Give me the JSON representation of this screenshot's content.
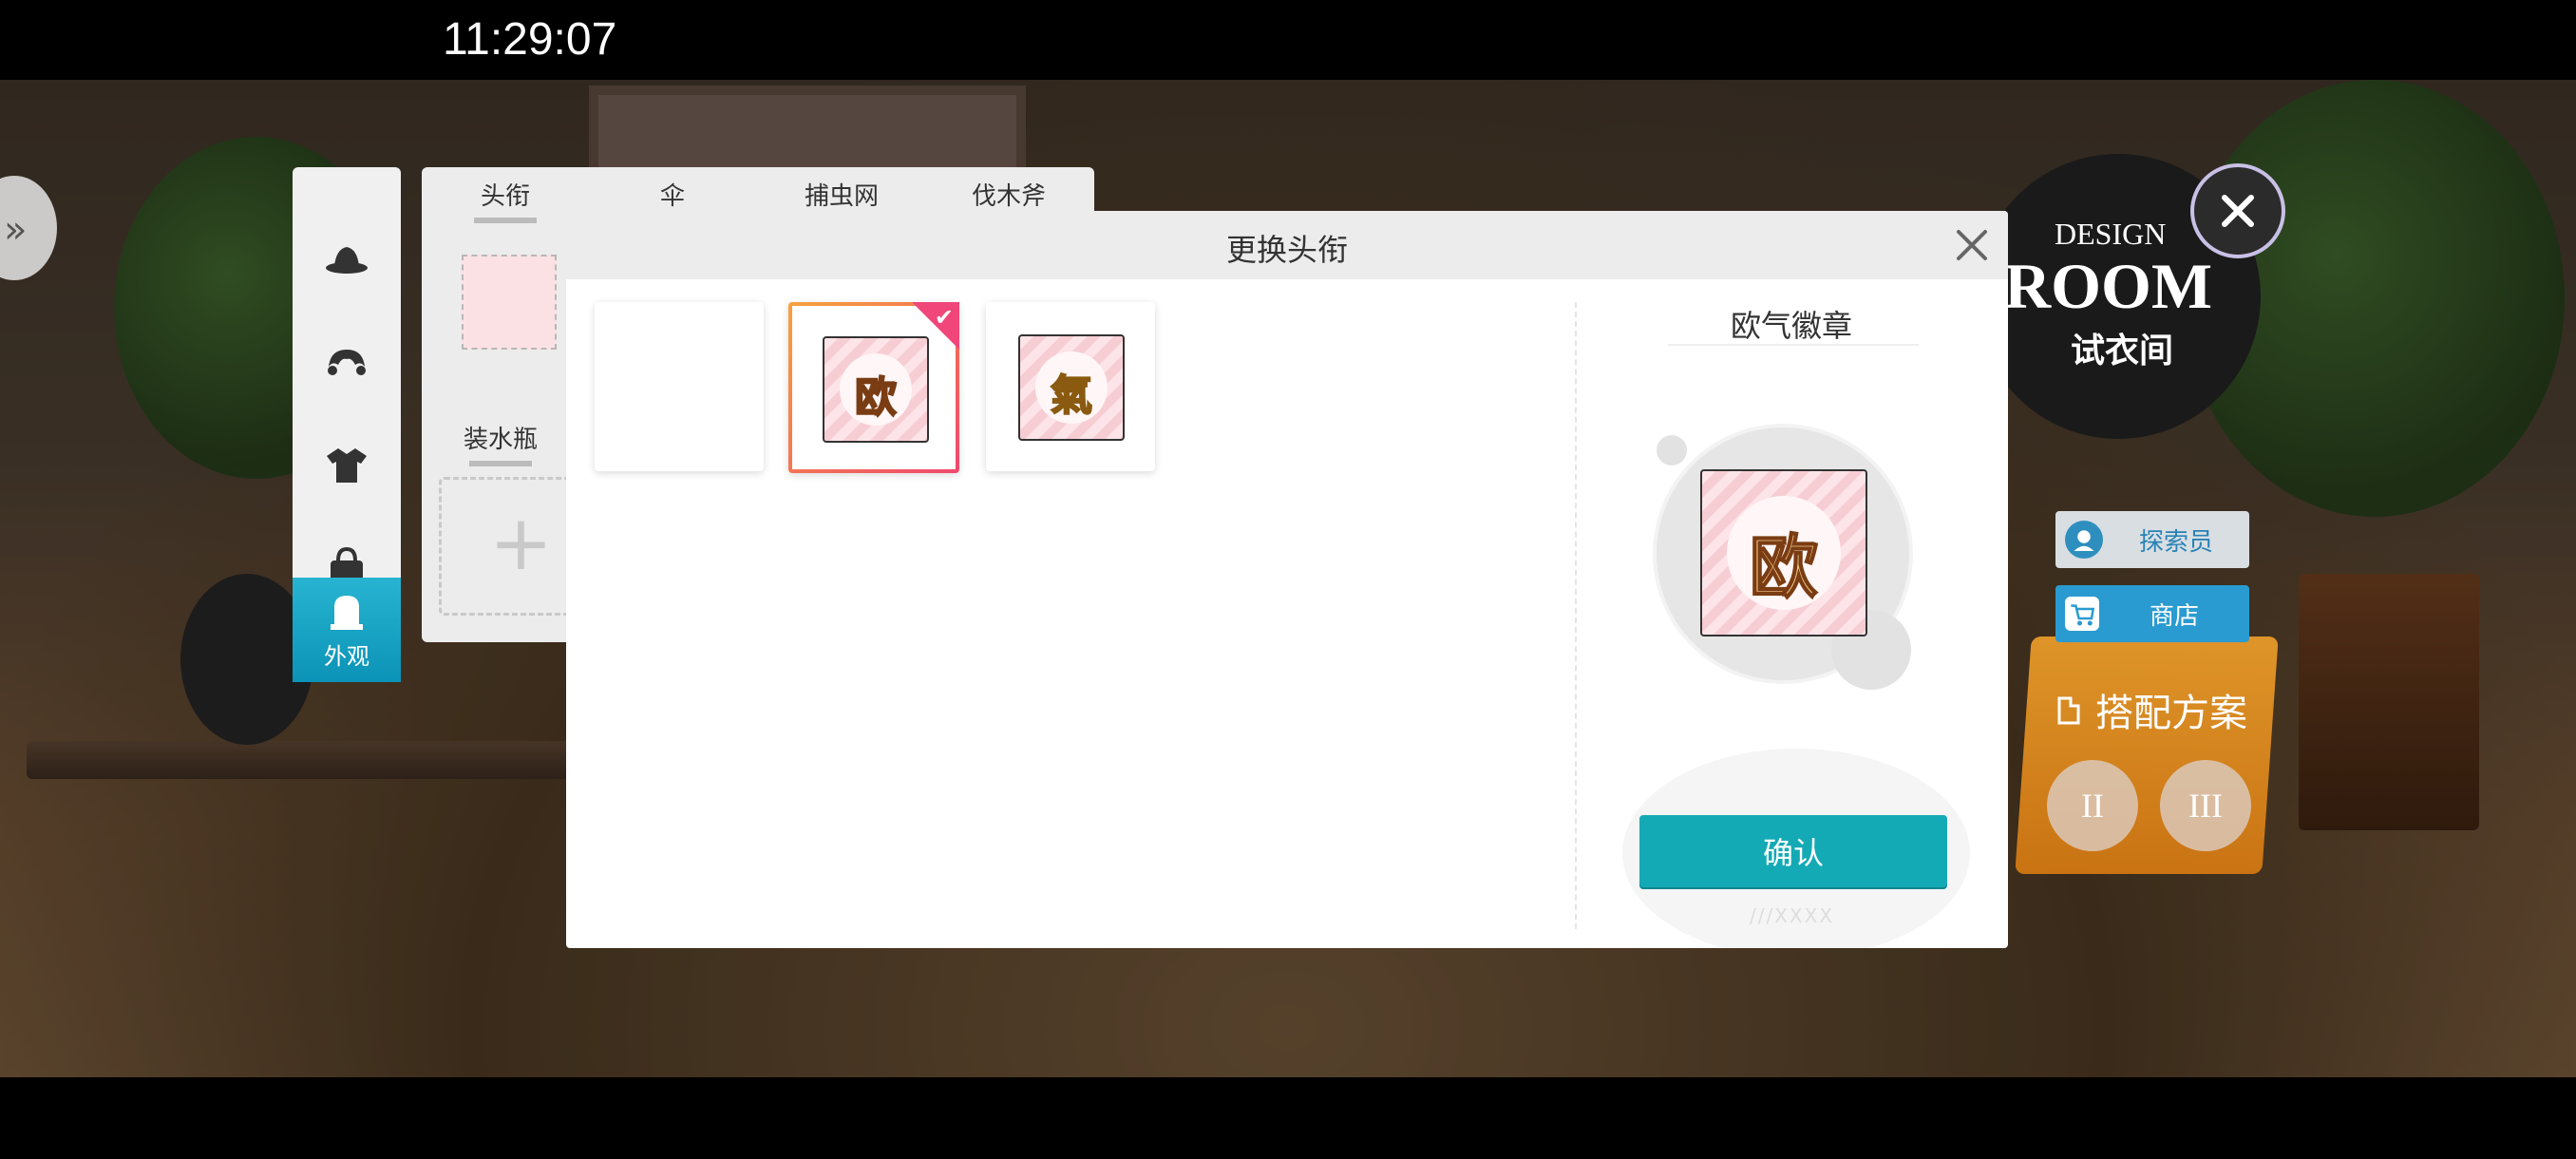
{
  "status_bar": {
    "time": "11:29:07"
  },
  "side_menu": {
    "items": [
      {
        "icon": "hat-icon"
      },
      {
        "icon": "hair-icon"
      },
      {
        "icon": "shirt-icon"
      },
      {
        "icon": "bag-icon"
      },
      {
        "icon": "appearance-icon",
        "label": "外观",
        "active": true
      }
    ]
  },
  "category_panel": {
    "tabs": [
      "头衔",
      "伞",
      "捕虫网",
      "伐木斧"
    ],
    "sub_label": "装水瓶",
    "add_symbol": "+"
  },
  "dialog": {
    "title": "更换头衔",
    "slots": [
      {
        "glyph": "",
        "selected": false
      },
      {
        "glyph": "欧",
        "selected": true
      },
      {
        "glyph": "氣",
        "selected": false
      }
    ],
    "check_mark": "✔",
    "detail": {
      "name": "欧气徽章",
      "glyph": "欧",
      "confirm_label": "确认",
      "deco": "///XXXX"
    }
  },
  "right_panel": {
    "design_line1": "DESIGN",
    "design_line2": "ROOM",
    "design_line3": "试衣间",
    "explorer_label": "探索员",
    "shop_label": "商店",
    "outfit_title": "搭配方案",
    "outfit_buttons": [
      "II",
      "III"
    ]
  },
  "colors": {
    "accent": "#14aab5",
    "selected_gradient_start": "#f7a23c",
    "selected_gradient_end": "#f0486f",
    "menu_active": "#1aa3c5",
    "shop_blue": "#2a9bd0"
  }
}
